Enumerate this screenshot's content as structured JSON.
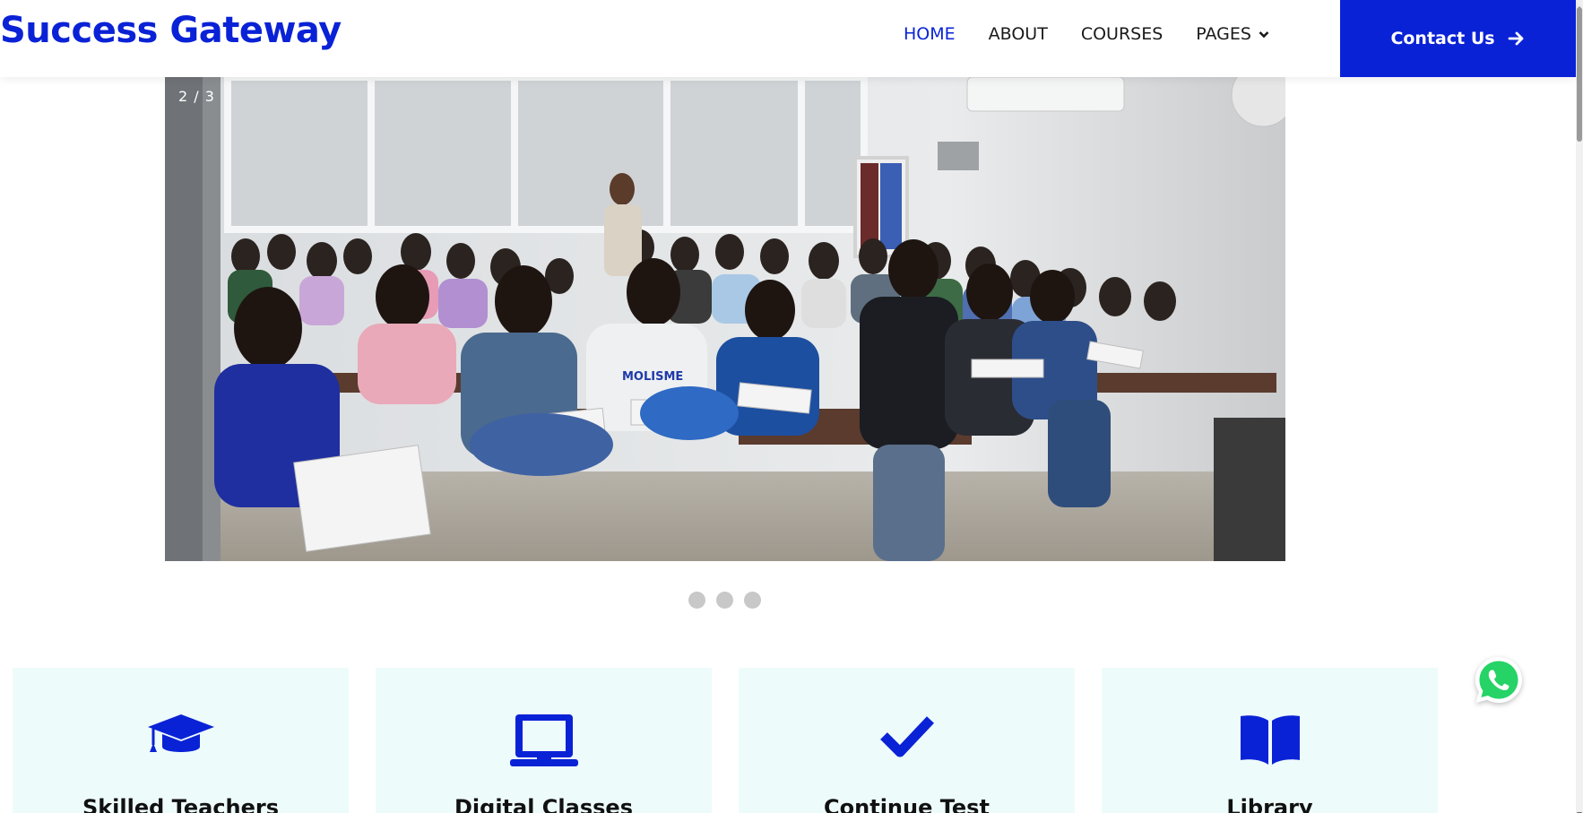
{
  "brand": {
    "name": "Success Gateway"
  },
  "nav": {
    "items": [
      {
        "label": "HOME"
      },
      {
        "label": "ABOUT"
      },
      {
        "label": "COURSES"
      },
      {
        "label": "PAGES"
      }
    ],
    "contact_label": "Contact Us"
  },
  "carousel": {
    "counter": "2 / 3",
    "slide_count": 3,
    "active_slide": 2,
    "image_description": "Classroom photo of students seated at wooden desks writing in notebooks, with a teacher standing at the back"
  },
  "features": [
    {
      "title": "Skilled Teachers",
      "icon": "graduation-cap-icon"
    },
    {
      "title": "Digital Classes",
      "icon": "laptop-icon"
    },
    {
      "title": "Continue Test",
      "icon": "check-icon"
    },
    {
      "title": "Library",
      "icon": "book-icon"
    }
  ],
  "colors": {
    "brand_blue": "#0a22d6",
    "card_bg": "#eefbfb",
    "whatsapp_green": "#25d366"
  }
}
